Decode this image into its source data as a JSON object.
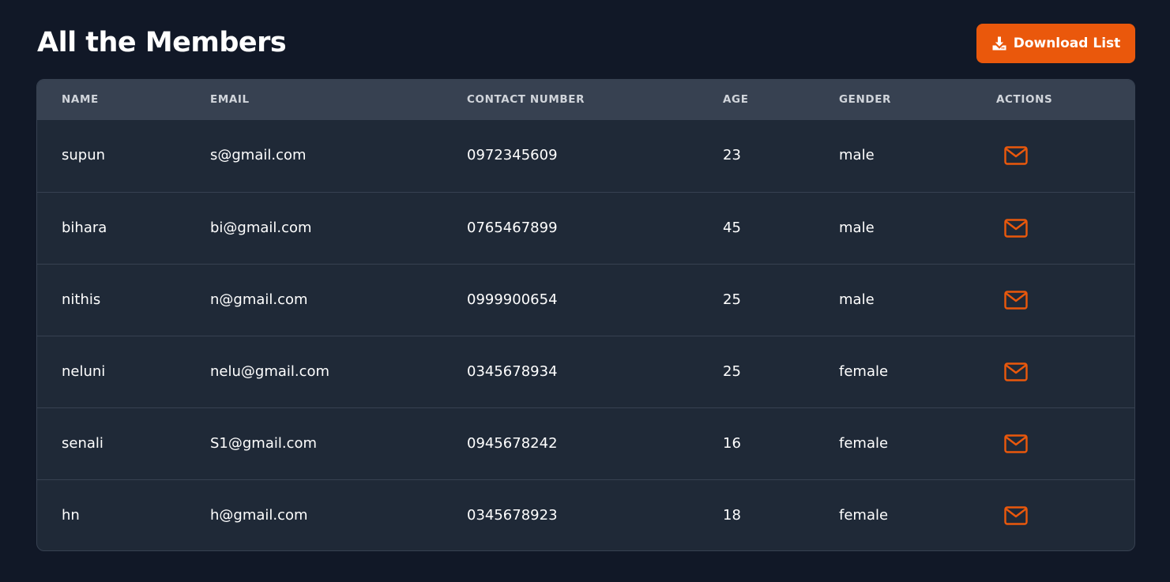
{
  "header": {
    "title": "All the Members",
    "download_label": "Download List"
  },
  "colors": {
    "accent": "#ea580c",
    "background": "#111827",
    "table_bg": "#1f2937",
    "header_bg": "#374151"
  },
  "table": {
    "columns": [
      "NAME",
      "EMAIL",
      "CONTACT NUMBER",
      "AGE",
      "GENDER",
      "ACTIONS"
    ],
    "rows": [
      {
        "name": "supun",
        "email": "s@gmail.com",
        "contact": "0972345609",
        "age": "23",
        "gender": "male",
        "action_icon": "mail-icon"
      },
      {
        "name": "bihara",
        "email": "bi@gmail.com",
        "contact": "0765467899",
        "age": "45",
        "gender": "male",
        "action_icon": "mail-icon"
      },
      {
        "name": "nithis",
        "email": "n@gmail.com",
        "contact": "0999900654",
        "age": "25",
        "gender": "male",
        "action_icon": "mail-icon"
      },
      {
        "name": "neluni",
        "email": "nelu@gmail.com",
        "contact": "0345678934",
        "age": "25",
        "gender": "female",
        "action_icon": "mail-icon"
      },
      {
        "name": "senali",
        "email": "S1@gmail.com",
        "contact": "0945678242",
        "age": "16",
        "gender": "female",
        "action_icon": "mail-icon"
      },
      {
        "name": "hn",
        "email": "h@gmail.com",
        "contact": "0345678923",
        "age": "18",
        "gender": "female",
        "action_icon": "mail-icon"
      }
    ]
  }
}
